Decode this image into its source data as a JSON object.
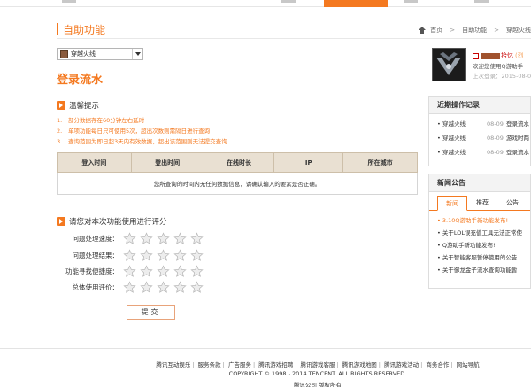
{
  "header": {
    "title": "自助功能",
    "breadcrumb": [
      "首页",
      "自助功能",
      "穿越火线"
    ]
  },
  "selector": {
    "value": "穿越火线"
  },
  "main": {
    "title": "登录流水"
  },
  "tips": {
    "heading": "温馨提示",
    "items": [
      {
        "n": "1.",
        "text": "部分数据存在60分钟左右延时"
      },
      {
        "n": "2.",
        "text": "单项功能每日只可使用5次，超出次数则需隔日进行查询"
      },
      {
        "n": "3.",
        "text": "查询范围为即日起3天内有效数据，超出该范围则无法提交查询"
      }
    ]
  },
  "table": {
    "columns": [
      "登入时间",
      "登出时间",
      "在线时长",
      "IP",
      "所在城市"
    ],
    "empty_message": "您所查询的时间内无任何数据信息，请确认输入的要素是否正确。"
  },
  "rating": {
    "heading": "请您对本次功能使用进行评分",
    "rows": [
      {
        "label": "问题处理速度：",
        "stars": 5
      },
      {
        "label": "问题处理结果：",
        "stars": 5
      },
      {
        "label": "功能寻找便捷度：",
        "stars": 5
      },
      {
        "label": "总体使用评价：",
        "stars": 5
      }
    ],
    "submit_label": "提交"
  },
  "profile": {
    "name_suffix": "拾忆",
    "name_extra": "(烈",
    "welcome": "欢迎您使用Q游助手",
    "last_login": "上次登录：2015-08-0"
  },
  "recent_ops": {
    "heading": "近期操作记录",
    "items": [
      {
        "game": "穿越火线",
        "date": "08-09",
        "service": "登录流水"
      },
      {
        "game": "穿越火线",
        "date": "08-09",
        "service": "游戏时两"
      },
      {
        "game": "穿越火线",
        "date": "08-09",
        "service": "登录流水"
      }
    ]
  },
  "news": {
    "heading": "新闻公告",
    "tabs": [
      "新闻",
      "推荐",
      "公告"
    ],
    "items": [
      {
        "text": "3.10Q游助手新功能发布!",
        "hot": true
      },
      {
        "text": "关于LOL误充值工具无法正常使",
        "hot": false
      },
      {
        "text": "Q游助手新功能发布!",
        "hot": false
      },
      {
        "text": "关于智能客服暂停使用的公告",
        "hot": false
      },
      {
        "text": "关于御龙金子流水查询功能暂",
        "hot": false
      }
    ]
  },
  "footer": {
    "links": [
      "腾讯互动娱乐",
      "服务条款",
      "广告服务",
      "腾讯游戏招聘",
      "腾讯游戏客服",
      "腾讯游戏地图",
      "腾讯游戏活动",
      "商务合作",
      "网站导航"
    ],
    "copyright": "COPYRIGHT © 1998 - 2014 TENCENT. ALL RIGHTS RESERVED.",
    "sub": "腾讯公司 版权所有"
  },
  "colors": {
    "accent": "#f47920",
    "table_header": "#e9e0d2"
  }
}
